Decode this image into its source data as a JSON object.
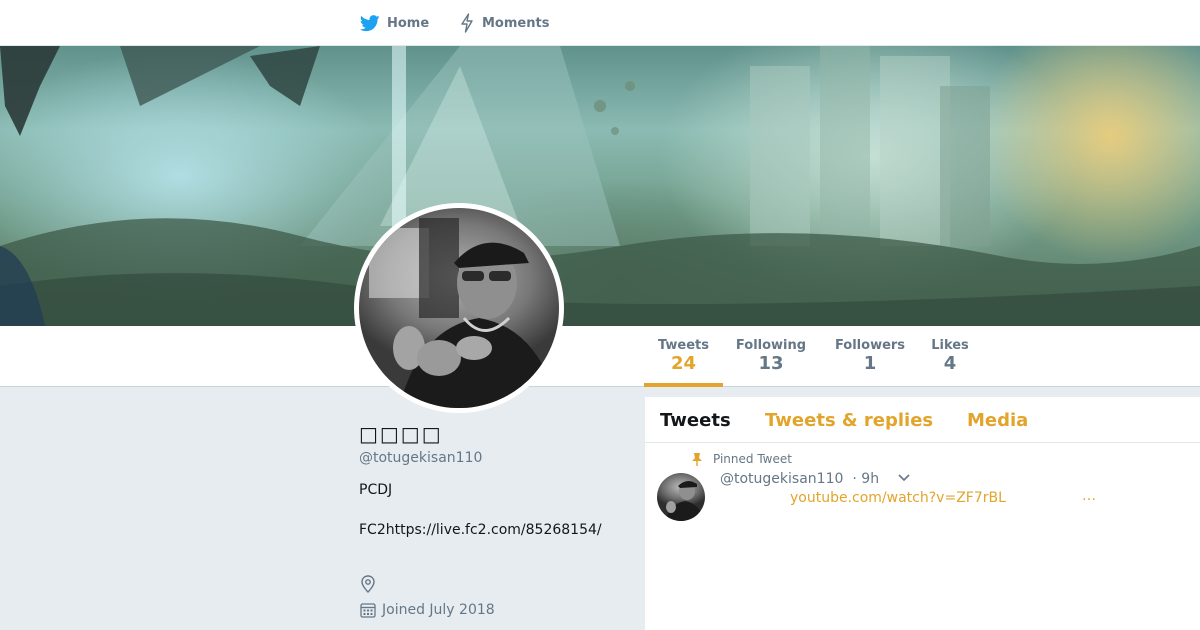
{
  "nav": {
    "home_label": "Home",
    "moments_label": "Moments"
  },
  "colors": {
    "accent": "#e2a42b",
    "twitter_blue": "#1da1f2",
    "muted": "#657786"
  },
  "stats": {
    "tweets": {
      "label": "Tweets",
      "value": "24"
    },
    "following": {
      "label": "Following",
      "value": "13"
    },
    "followers": {
      "label": "Followers",
      "value": "1"
    },
    "likes": {
      "label": "Likes",
      "value": "4"
    }
  },
  "profile": {
    "name": "□□□□",
    "handle": "@totugekisan110",
    "bio_line1": "PCDJ",
    "bio_line2": "FC2https://live.fc2.com/85268154/",
    "joined": "Joined July 2018"
  },
  "timeline": {
    "tabs": [
      "Tweets",
      "Tweets & replies",
      "Media"
    ],
    "pinned_label": "Pinned Tweet",
    "tweet": {
      "handle": "@totugekisan110",
      "time": "· 9h",
      "link": "youtube.com/watch?v=ZF7rBL",
      "ellipsis": "…"
    }
  },
  "icons": {
    "home": "twitter-bird-icon",
    "moments": "lightning-icon",
    "location": "location-pin-icon",
    "calendar": "calendar-icon",
    "pin": "pin-icon",
    "caret": "chevron-down-icon"
  }
}
